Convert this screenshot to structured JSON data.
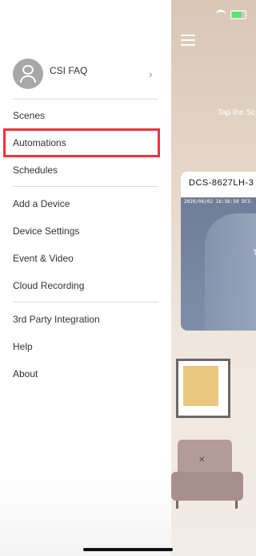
{
  "profile": {
    "name": "CSI FAQ"
  },
  "menu": {
    "scenes": "Scenes",
    "automations": "Automations",
    "schedules": "Schedules",
    "add_device": "Add a Device",
    "device_settings": "Device Settings",
    "event_video": "Event & Video",
    "cloud_recording": "Cloud Recording",
    "third_party": "3rd Party Integration",
    "help": "Help",
    "about": "About"
  },
  "background": {
    "tap_hint": "Tap the Sc",
    "camera_name": "DCS-8627LH-3",
    "camera_timestamp": "2020/06/02  16:56:50  DCS-",
    "camera_overlay_char": "T"
  },
  "colors": {
    "highlight": "#ef3340"
  },
  "icons": {
    "avatar": "user-avatar-icon",
    "chevron": "chevron-right-icon",
    "menu": "hamburger-icon"
  }
}
